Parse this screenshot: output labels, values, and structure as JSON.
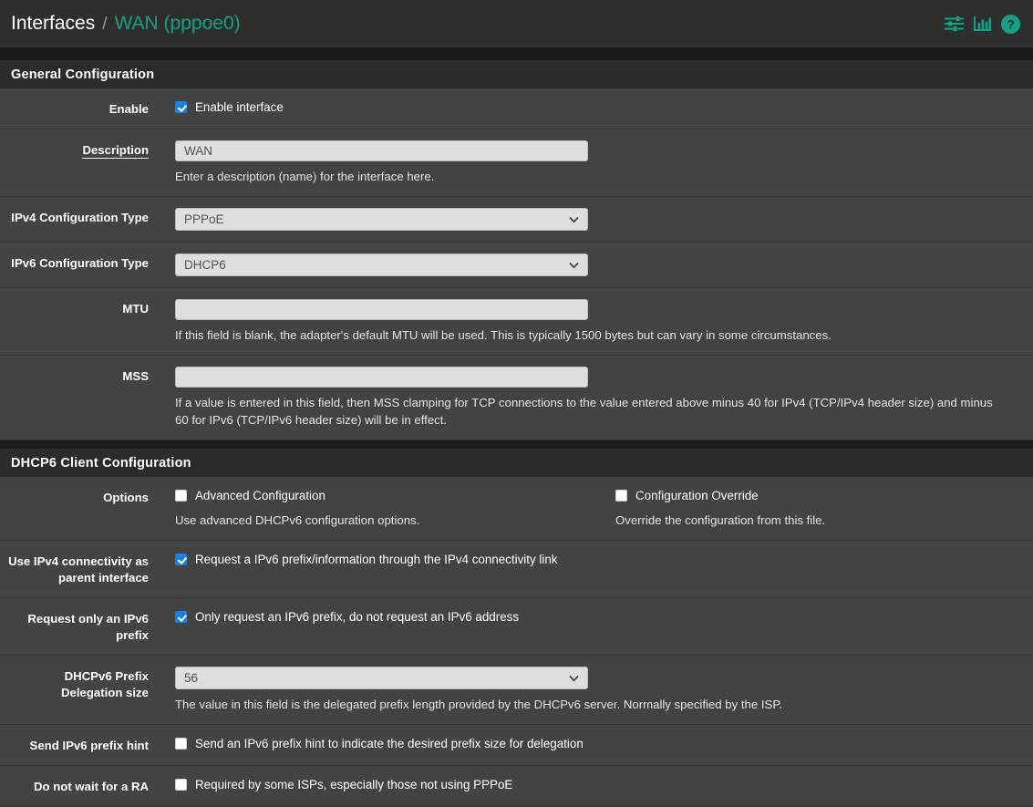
{
  "header": {
    "breadcrumb_root": "Interfaces",
    "breadcrumb_separator": "/",
    "breadcrumb_leaf": "WAN (pppoe0)",
    "accent_color": "#14a085",
    "icons": [
      "sliders-icon",
      "bar-chart-icon",
      "help-icon"
    ]
  },
  "sections": [
    {
      "title": "General Configuration"
    },
    {
      "title": "DHCP6 Client Configuration"
    }
  ],
  "general": {
    "enable": {
      "label": "Enable",
      "checkbox_label": "Enable interface",
      "checked": true
    },
    "description": {
      "label": "Description",
      "value": "WAN",
      "placeholder": "",
      "help": "Enter a description (name) for the interface here."
    },
    "ipv4_type": {
      "label": "IPv4 Configuration Type",
      "value": "PPPoE"
    },
    "ipv6_type": {
      "label": "IPv6 Configuration Type",
      "value": "DHCP6"
    },
    "mtu": {
      "label": "MTU",
      "value": "",
      "placeholder": "",
      "help": "If this field is blank, the adapter's default MTU will be used. This is typically 1500 bytes but can vary in some circumstances."
    },
    "mss": {
      "label": "MSS",
      "value": "",
      "placeholder": "",
      "help": "If a value is entered in this field, then MSS clamping for TCP connections to the value entered above minus 40 for IPv4 (TCP/IPv4 header size) and minus 60 for IPv6 (TCP/IPv6 header size) will be in effect."
    }
  },
  "dhcp6": {
    "options": {
      "label": "Options",
      "advanced": {
        "checkbox_label": "Advanced Configuration",
        "checked": false,
        "help": "Use advanced DHCPv6 configuration options."
      },
      "override": {
        "checkbox_label": "Configuration Override",
        "checked": false,
        "help": "Override the configuration from this file."
      }
    },
    "parent_interface": {
      "label": "Use IPv4 connectivity as parent interface",
      "checkbox_label": "Request a IPv6 prefix/information through the IPv4 connectivity link",
      "checked": true
    },
    "prefix_only": {
      "label": "Request only an IPv6 prefix",
      "checkbox_label": "Only request an IPv6 prefix, do not request an IPv6 address",
      "checked": true
    },
    "delegation_size": {
      "label": "DHCPv6 Prefix Delegation size",
      "value": "56",
      "help": "The value in this field is the delegated prefix length provided by the DHCPv6 server. Normally specified by the ISP."
    },
    "prefix_hint": {
      "label": "Send IPv6 prefix hint",
      "checkbox_label": "Send an IPv6 prefix hint to indicate the desired prefix size for delegation",
      "checked": false
    },
    "no_wait_ra": {
      "label": "Do not wait for a RA",
      "checkbox_label": "Required by some ISPs, especially those not using PPPoE",
      "checked": false
    }
  }
}
